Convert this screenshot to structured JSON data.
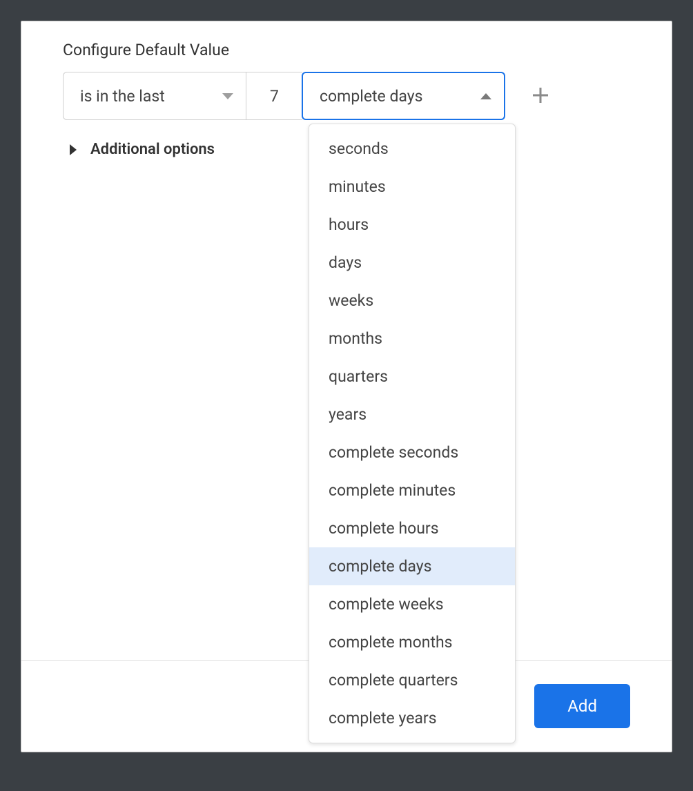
{
  "title": "Configure Default Value",
  "filter": {
    "condition_label": "is in the last",
    "number_value": "7",
    "unit_selected": "complete days"
  },
  "additional_options_label": "Additional options",
  "add_button_label": "Add",
  "unit_options": [
    {
      "label": "seconds",
      "selected": false
    },
    {
      "label": "minutes",
      "selected": false
    },
    {
      "label": "hours",
      "selected": false
    },
    {
      "label": "days",
      "selected": false
    },
    {
      "label": "weeks",
      "selected": false
    },
    {
      "label": "months",
      "selected": false
    },
    {
      "label": "quarters",
      "selected": false
    },
    {
      "label": "years",
      "selected": false
    },
    {
      "label": "complete seconds",
      "selected": false
    },
    {
      "label": "complete minutes",
      "selected": false
    },
    {
      "label": "complete hours",
      "selected": false
    },
    {
      "label": "complete days",
      "selected": true
    },
    {
      "label": "complete weeks",
      "selected": false
    },
    {
      "label": "complete months",
      "selected": false
    },
    {
      "label": "complete quarters",
      "selected": false
    },
    {
      "label": "complete years",
      "selected": false
    }
  ]
}
